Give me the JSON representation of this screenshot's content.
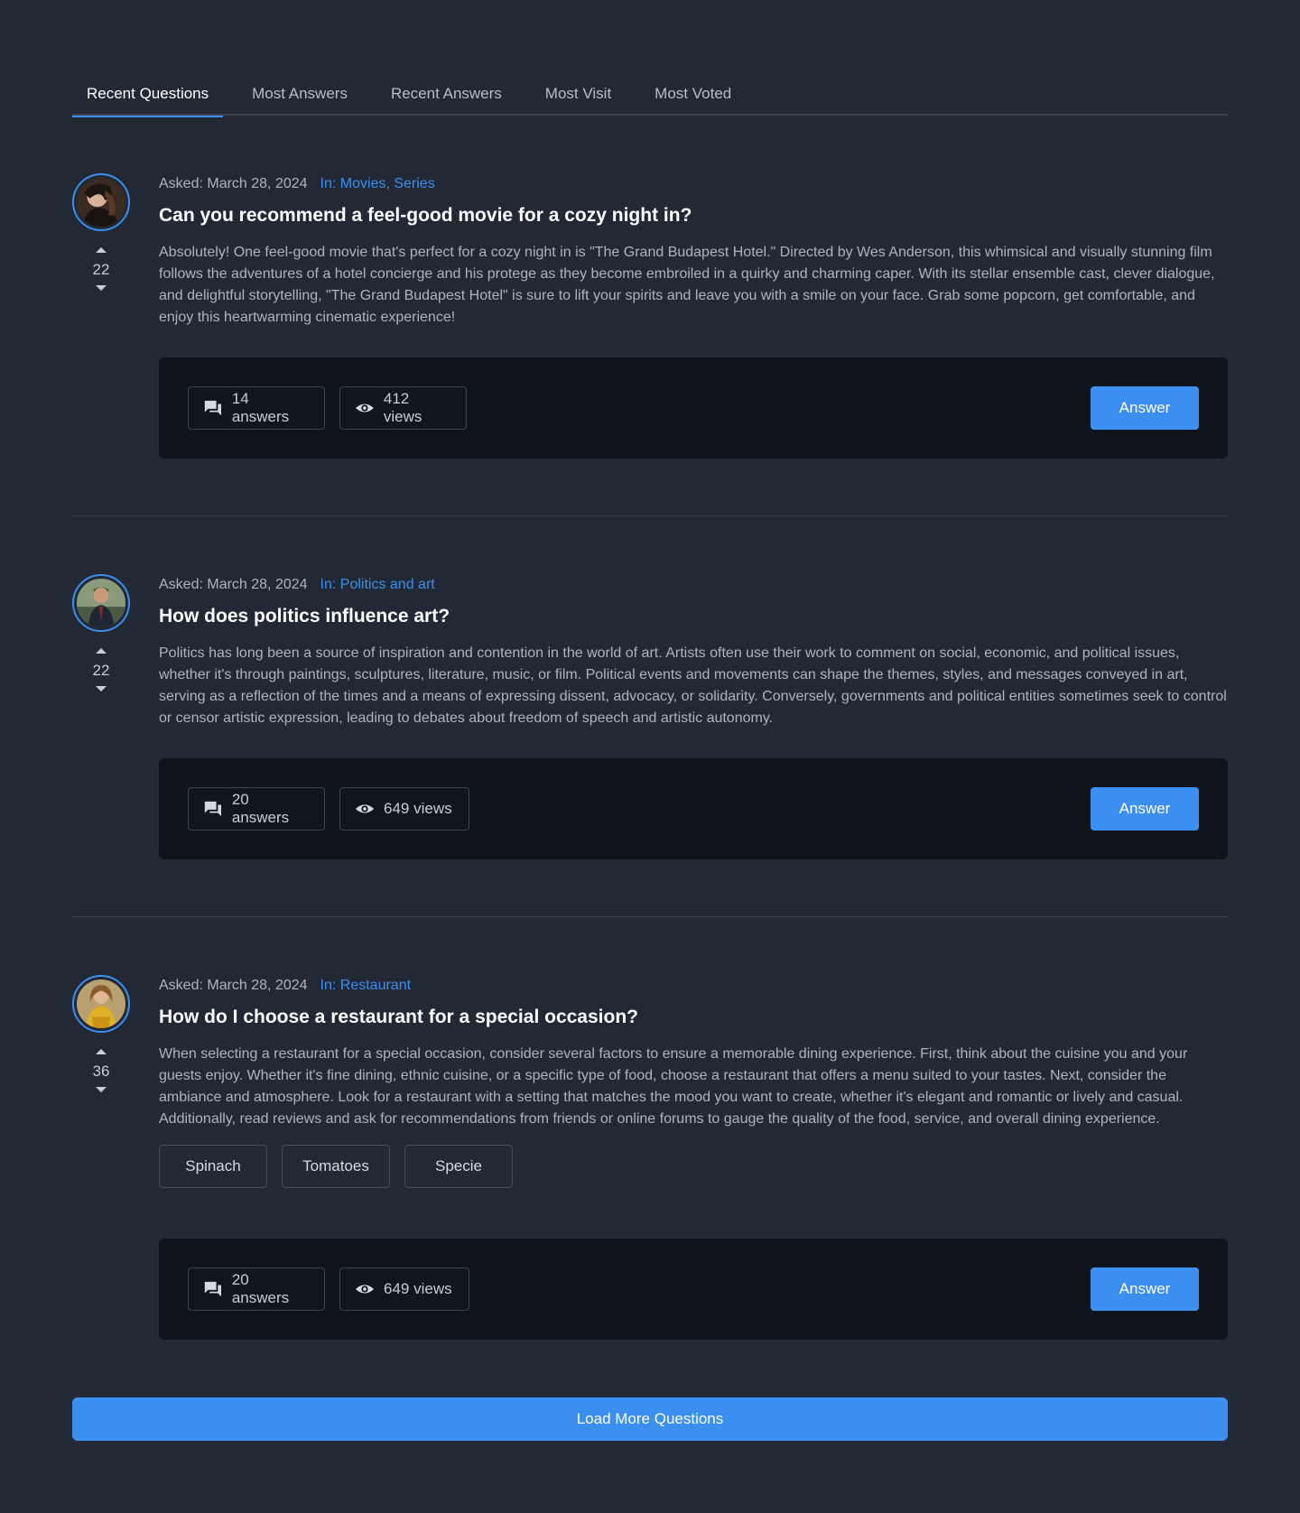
{
  "tabs": [
    {
      "label": "Recent Questions",
      "active": true
    },
    {
      "label": "Most Answers"
    },
    {
      "label": "Recent Answers"
    },
    {
      "label": "Most Visit"
    },
    {
      "label": "Most Voted"
    }
  ],
  "questions": [
    {
      "asked": "Asked: March 28, 2024",
      "category": "In: Movies, Series",
      "title": "Can you recommend a feel-good movie for a cozy night in?",
      "body": "Absolutely! One feel-good movie that's perfect for a cozy night in is \"The Grand Budapest Hotel.\" Directed by Wes Anderson, this whimsical and visually stunning film follows the adventures of a hotel concierge and his protege as they become embroiled in a quirky and charming caper. With its stellar ensemble cast, clever dialogue, and delightful storytelling, \"The Grand Budapest Hotel\" is sure to lift your spirits and leave you with a smile on your face. Grab some popcorn, get comfortable, and enjoy this heartwarming cinematic experience!",
      "votes": "22",
      "answers": "14 answers",
      "views": "412 views",
      "answer_label": "Answer"
    },
    {
      "asked": "Asked: March 28, 2024",
      "category": "In: Politics and art",
      "title": "How does politics influence art?",
      "body": "Politics has long been a source of inspiration and contention in the world of art. Artists often use their work to comment on social, economic, and political issues, whether it's through paintings, sculptures, literature, music, or film. Political events and movements can shape the themes, styles, and messages conveyed in art, serving as a reflection of the times and a means of expressing dissent, advocacy, or solidarity. Conversely, governments and political entities sometimes seek to control or censor artistic expression, leading to debates about freedom of speech and artistic autonomy.",
      "votes": "22",
      "answers": "20 answers",
      "views": "649 views",
      "answer_label": "Answer"
    },
    {
      "asked": "Asked: March 28, 2024",
      "category": "In: Restaurant",
      "title": "How do I choose a restaurant for a special occasion?",
      "body": "When selecting a restaurant for a special occasion, consider several factors to ensure a memorable dining experience. First, think about the cuisine you and your guests enjoy. Whether it's fine dining, ethnic cuisine, or a specific type of food, choose a restaurant that offers a menu suited to your tastes. Next, consider the ambiance and atmosphere. Look for a restaurant with a setting that matches the mood you want to create, whether it's elegant and romantic or lively and casual. Additionally, read reviews and ask for recommendations from friends or online forums to gauge the quality of the food, service, and overall dining experience.",
      "tags": [
        "Spinach",
        "Tomatoes",
        "Specie"
      ],
      "votes": "36",
      "answers": "20 answers",
      "views": "649 views",
      "answer_label": "Answer"
    }
  ],
  "load_more": "Load More Questions",
  "icons": {
    "vote_up": "caret-up-icon",
    "vote_down": "caret-down-icon",
    "answers": "chat-bubbles-icon",
    "views": "eye-icon"
  },
  "colors": {
    "background": "#222934",
    "accent": "#3b8ff0",
    "footer": "#0f141c"
  }
}
